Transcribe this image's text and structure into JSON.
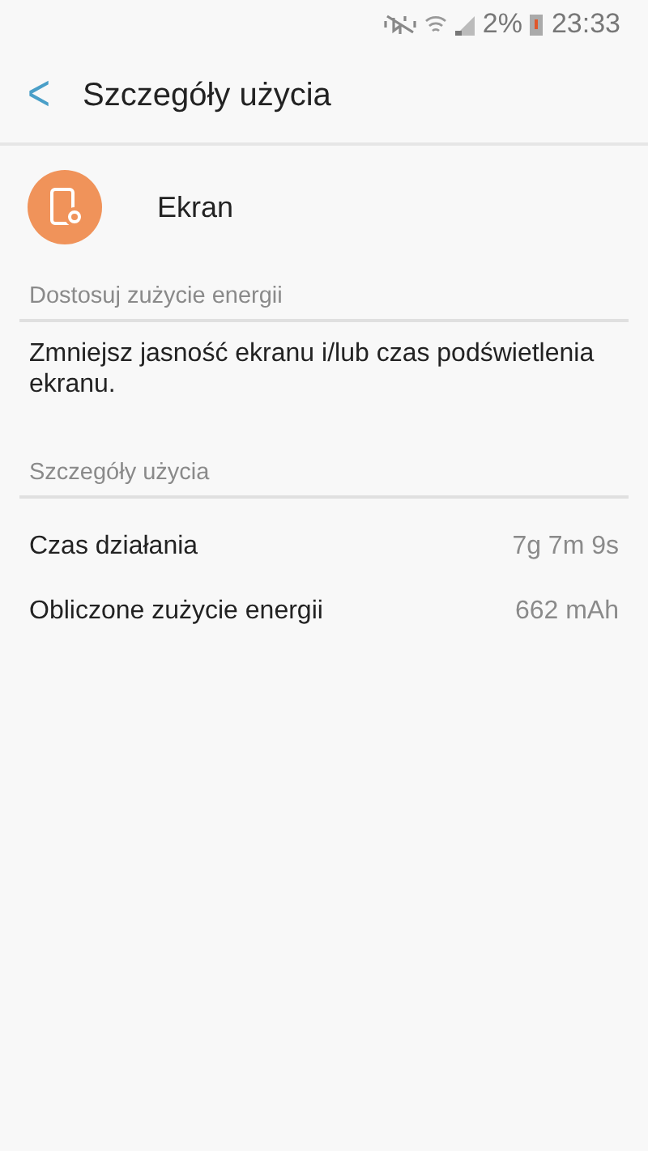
{
  "status_bar": {
    "battery_percent": "2%",
    "time": "23:33"
  },
  "header": {
    "back": "<",
    "title": "Szczegóły użycia"
  },
  "app": {
    "name": "Ekran"
  },
  "sections": [
    {
      "title": "Dostosuj zużycie energii",
      "kind": "text",
      "text": "Zmniejsz jasność ekranu i/lub czas podświetlenia ekranu."
    },
    {
      "title": "Szczegóły użycia",
      "kind": "rows",
      "rows": [
        {
          "label": "Czas działania",
          "value": "7g 7m 9s"
        },
        {
          "label": "Obliczone zużycie energii",
          "value": "662 mAh"
        }
      ]
    }
  ]
}
